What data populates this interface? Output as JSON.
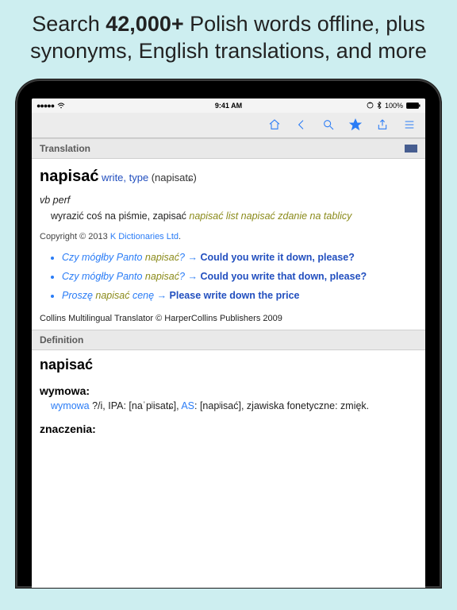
{
  "headline": {
    "pre": "Search ",
    "bold": "42,000+",
    "post": " Polish words offline, plus synonyms, English translations, and more"
  },
  "statusbar": {
    "carrier_dots": "●●●●●",
    "wifi": "wifi",
    "time": "9:41 AM",
    "battery": "100%"
  },
  "sections": {
    "translation": "Translation",
    "definition": "Definition"
  },
  "entry": {
    "headword": "napisać",
    "translations": "write, type",
    "pronunciation": "(napisatɕ)",
    "pos": "vb perf",
    "definition_pre": "wyrazić coś na piśmie, zapisać ",
    "definition_ex": "napisać list napisać zdanie na tablicy"
  },
  "copyright": {
    "pre": "Copyright © 2013 ",
    "link": "K Dictionaries Ltd",
    "post": "."
  },
  "examples": [
    {
      "pl_pre": "Czy mógłby Panto ",
      "pl_kw": "napisać",
      "pl_post": "?",
      "en": "Could you write it down, please?"
    },
    {
      "pl_pre": "Czy mógłby Panto ",
      "pl_kw": "napisać",
      "pl_post": "?",
      "en": "Could you write that down, please?"
    },
    {
      "pl_pre": "Proszę ",
      "pl_kw": "napisać",
      "pl_post": " cenę",
      "en": "Please write down the price"
    }
  ],
  "collins": "Collins Multilingual Translator © HarperCollins Publishers 2009",
  "definition_block": {
    "headword": "napisać",
    "wymowa_label": "wymowa:",
    "wymowa_link": "wymowa",
    "wymowa_mid1": " ?/i, IPA: [naˈpʲisatɕ], ",
    "wymowa_as": "AS",
    "wymowa_mid2": ": [napʲisać], zjawiska fonetyczne: zmięk.",
    "znaczenia_label": "znaczenia:"
  }
}
